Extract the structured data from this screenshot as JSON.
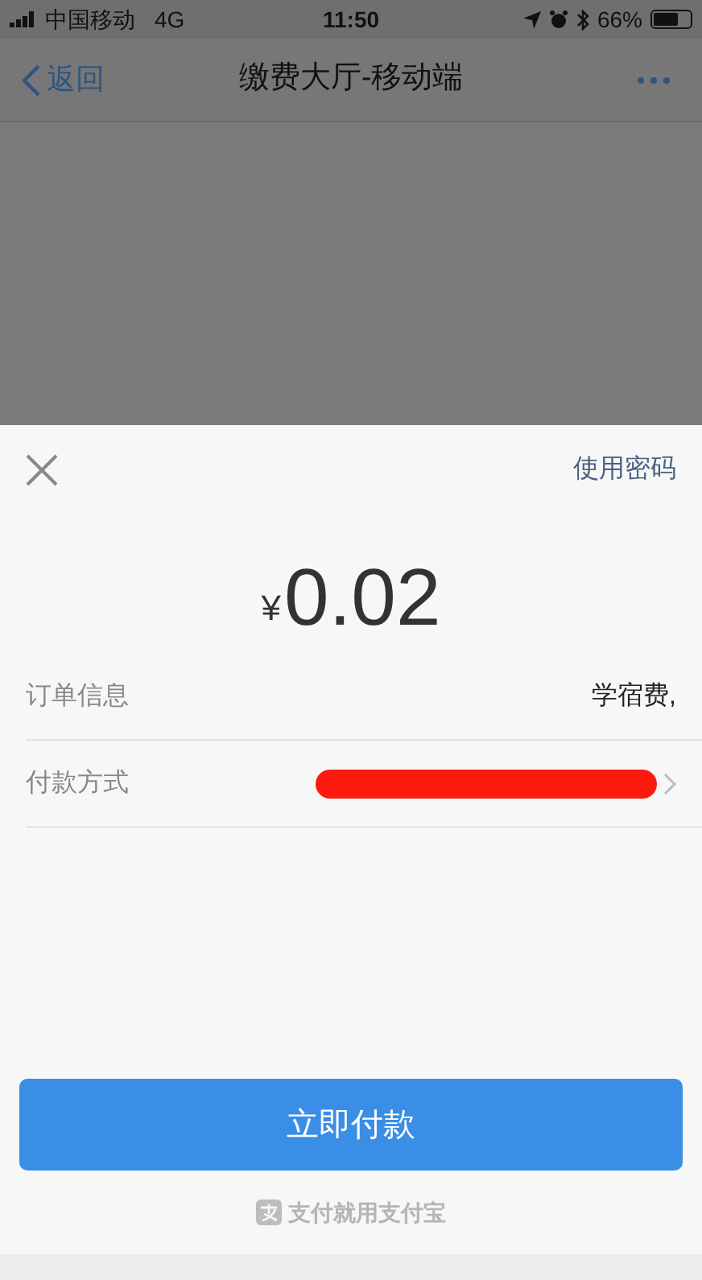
{
  "status_bar": {
    "carrier": "中国移动",
    "network": "4G",
    "time": "11:50",
    "battery_text": "66%"
  },
  "nav": {
    "back": "返回",
    "title": "缴费大厅-移动端"
  },
  "sheet": {
    "use_password": "使用密码",
    "currency": "¥",
    "amount": "0.02",
    "rows": [
      {
        "kind": "text",
        "label": "订单信息",
        "value": "学宿费,"
      },
      {
        "kind": "redacted",
        "label": "付款方式"
      }
    ],
    "pay_button": "立即付款",
    "footer": "支付就用支付宝"
  }
}
